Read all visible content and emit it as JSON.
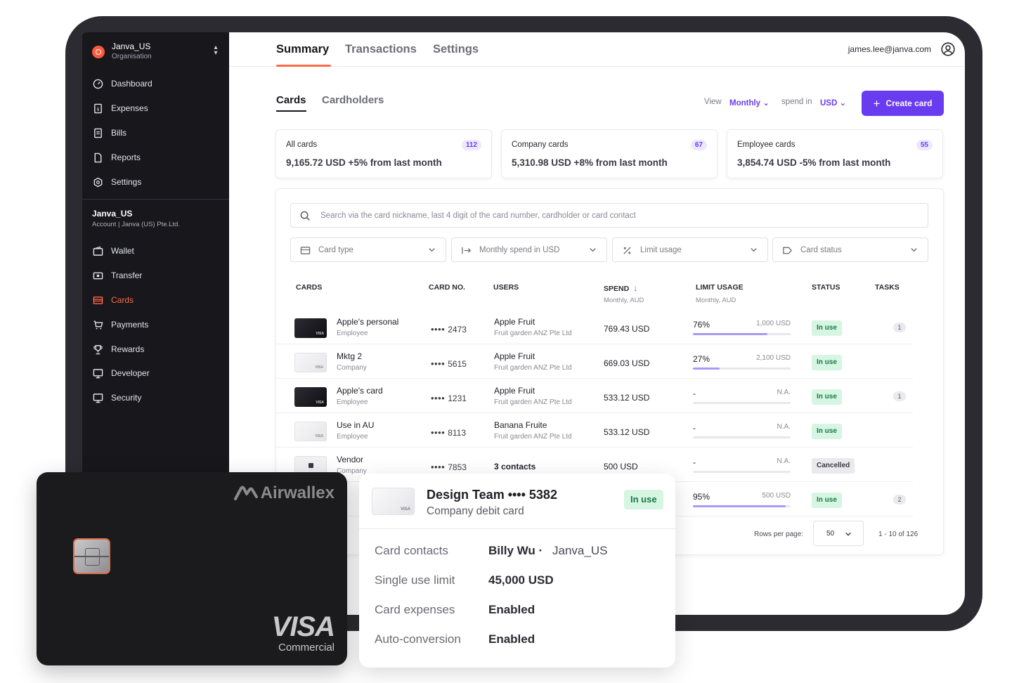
{
  "sidebar": {
    "org": {
      "name": "Janva_US",
      "sub": "Organisation"
    },
    "nav_top": [
      {
        "label": "Dashboard",
        "icon": "dashboard-icon"
      },
      {
        "label": "Expenses",
        "icon": "receipt-icon"
      },
      {
        "label": "Bills",
        "icon": "document-icon"
      },
      {
        "label": "Reports",
        "icon": "report-icon"
      },
      {
        "label": "Settings",
        "icon": "gear-icon"
      }
    ],
    "account": {
      "name": "Janva_US",
      "sub": "Account | Janva (US) Pte.Ltd."
    },
    "nav_bottom": [
      {
        "label": "Wallet",
        "icon": "wallet-icon"
      },
      {
        "label": "Transfer",
        "icon": "transfer-icon"
      },
      {
        "label": "Cards",
        "icon": "card-icon",
        "active": true
      },
      {
        "label": "Payments",
        "icon": "cart-icon"
      },
      {
        "label": "Rewards",
        "icon": "trophy-icon"
      },
      {
        "label": "Developer",
        "icon": "monitor-icon"
      },
      {
        "label": "Security",
        "icon": "monitor-icon"
      }
    ]
  },
  "topnav": {
    "tabs": [
      "Summary",
      "Transactions",
      "Settings"
    ],
    "user_email": "james.lee@janva.com"
  },
  "subheader": {
    "tabs": [
      "Cards",
      "Cardholders"
    ],
    "view_label": "View",
    "view_value": "Monthly",
    "spend_label": "spend in",
    "currency": "USD",
    "create_button": "Create card"
  },
  "stats": [
    {
      "label": "All cards",
      "count": "112",
      "value": "9,165.72 USD  +5% from last month"
    },
    {
      "label": "Company cards",
      "count": "67",
      "value": "5,310.98 USD  +8% from last month"
    },
    {
      "label": "Employee cards",
      "count": "55",
      "value": "3,854.74 USD  -5% from last month"
    }
  ],
  "table": {
    "search_placeholder": "Search via the card nickname, last 4 digit of the card number, cardholder or card contact",
    "filters": [
      "Card type",
      "Monthly spend in USD",
      "Limit usage",
      "Card status"
    ],
    "headers": {
      "cards": "CARDS",
      "card_no": "CARD NO.",
      "users": "USERS",
      "spend": "SPEND",
      "spend_sub": "Monthly, AUD",
      "limit": "LIMIT USAGE",
      "limit_sub": "Monthly, AUD",
      "status": "STATUS",
      "tasks": "TASKS"
    },
    "rows": [
      {
        "name": "Apple's personal",
        "type": "Employee",
        "dots": "••••",
        "no": "2473",
        "user": "Apple Fruit",
        "org": "Fruit garden ANZ Pte Ltd",
        "spend": "769.43 USD",
        "pct": "76%",
        "limit": "1,000 USD",
        "usage": 0.76,
        "status": "In use",
        "task": "1",
        "thumb": "dark"
      },
      {
        "name": "Mktg 2",
        "type": "Company",
        "dots": "••••",
        "no": "5615",
        "user": "Apple Fruit",
        "org": "Fruit garden ANZ Pte Ltd",
        "spend": "669.03 USD",
        "pct": "27%",
        "limit": "2,100 USD",
        "usage": 0.27,
        "status": "In use",
        "task": "",
        "thumb": "light"
      },
      {
        "name": "Apple's card",
        "type": "Employee",
        "dots": "••••",
        "no": "1231",
        "user": "Apple Fruit",
        "org": "Fruit garden ANZ Pte Ltd",
        "spend": "533.12 USD",
        "pct": "-",
        "limit": "N.A.",
        "usage": 0,
        "status": "In use",
        "task": "1",
        "thumb": "dark"
      },
      {
        "name": "Use in AU",
        "type": "Employee",
        "dots": "••••",
        "no": "8113",
        "user": "Banana Fruite",
        "org": "Fruit garden ANZ Pte Ltd",
        "spend": "533.12 USD",
        "pct": "-",
        "limit": "N.A.",
        "usage": 0,
        "status": "In use",
        "task": "",
        "thumb": "light"
      },
      {
        "name": "Vendor",
        "type": "Company",
        "dots": "••••",
        "no": "7853",
        "user": "3 contacts",
        "org": "",
        "spend": "500 USD",
        "pct": "-",
        "limit": "N.A.",
        "usage": 0,
        "status": "Cancelled",
        "task": "",
        "thumb": "lock"
      },
      {
        "name": "",
        "type": "",
        "dots": "",
        "no": "",
        "user": "",
        "org": "",
        "spend": "",
        "pct": "95%",
        "limit": "500 USD",
        "usage": 0.95,
        "status": "In use",
        "task": "2",
        "thumb": "none"
      }
    ],
    "rows_per_page_label": "Rows per page:",
    "rows_per_page": "50",
    "range": "1 - 10 of 126"
  },
  "physical_card": {
    "brand": "Airwallex",
    "network": "VISA",
    "network_sub": "Commercial"
  },
  "popup": {
    "title": "Design Team  •••• 5382",
    "subtitle": "Company debit card",
    "status": "In use",
    "fields": [
      {
        "key": "Card contacts",
        "value": "Billy Wu ·",
        "extra": "Janva_US"
      },
      {
        "key": "Single use limit",
        "value": "45,000 USD",
        "extra": ""
      },
      {
        "key": "Card expenses",
        "value": "Enabled",
        "extra": ""
      },
      {
        "key": "Auto-conversion",
        "value": "Enabled",
        "extra": ""
      }
    ]
  },
  "colors": {
    "accent": "#6a3cf0",
    "active_nav": "#ff6a45",
    "in_use_bg": "#d6f5e3"
  }
}
